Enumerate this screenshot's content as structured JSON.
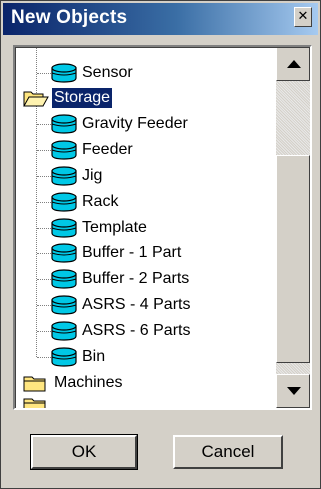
{
  "window": {
    "title": "New Objects",
    "close_glyph": "✕"
  },
  "tree": {
    "items": [
      {
        "label": "Sensor",
        "level": 1,
        "icon": "cylinder-icon",
        "selected": false
      },
      {
        "label": "Storage",
        "level": 0,
        "icon": "folder-open-icon",
        "selected": true
      },
      {
        "label": "Gravity Feeder",
        "level": 1,
        "icon": "cylinder-icon",
        "selected": false
      },
      {
        "label": "Feeder",
        "level": 1,
        "icon": "cylinder-icon",
        "selected": false
      },
      {
        "label": "Jig",
        "level": 1,
        "icon": "cylinder-icon",
        "selected": false
      },
      {
        "label": "Rack",
        "level": 1,
        "icon": "cylinder-icon",
        "selected": false
      },
      {
        "label": "Template",
        "level": 1,
        "icon": "cylinder-icon",
        "selected": false
      },
      {
        "label": "Buffer - 1 Part",
        "level": 1,
        "icon": "cylinder-icon",
        "selected": false
      },
      {
        "label": "Buffer - 2 Parts",
        "level": 1,
        "icon": "cylinder-icon",
        "selected": false
      },
      {
        "label": "ASRS - 4 Parts",
        "level": 1,
        "icon": "cylinder-icon",
        "selected": false
      },
      {
        "label": "ASRS - 6 Parts",
        "level": 1,
        "icon": "cylinder-icon",
        "selected": false
      },
      {
        "label": "Bin",
        "level": 1,
        "icon": "cylinder-icon",
        "selected": false
      },
      {
        "label": "Machines",
        "level": 0,
        "icon": "folder-closed-icon",
        "selected": false
      }
    ]
  },
  "buttons": {
    "ok": "OK",
    "cancel": "Cancel"
  },
  "colors": {
    "selection": "#0a246a",
    "cylinder": "#00c8e6",
    "folder": "#ffe680"
  }
}
